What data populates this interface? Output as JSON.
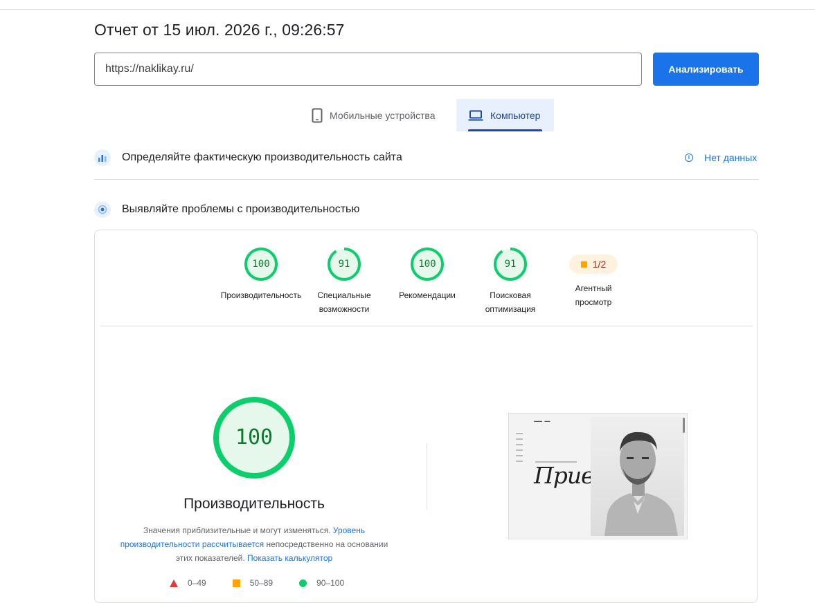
{
  "report": {
    "title": "Отчет от 15 июл. 2026 г., 09:26:57",
    "url_value": "https://naklikay.ru/",
    "analyze_label": "Анализировать"
  },
  "tabs": [
    {
      "label": "Мобильные устройства",
      "icon": "phone-icon",
      "active": false
    },
    {
      "label": "Компьютер",
      "icon": "laptop-icon",
      "active": true
    }
  ],
  "field_data": {
    "heading": "Определяйте фактическую производительность сайта",
    "status": "Нет данных"
  },
  "lab_data": {
    "heading": "Выявляйте проблемы с производительностью"
  },
  "scores": [
    {
      "value": "100",
      "label_line1": "Производительность",
      "label_line2": "",
      "fraction": 1.0
    },
    {
      "value": "91",
      "label_line1": "Специальные",
      "label_line2": "возможности",
      "fraction": 0.91
    },
    {
      "value": "100",
      "label_line1": "Рекомендации",
      "label_line2": "",
      "fraction": 1.0
    },
    {
      "value": "91",
      "label_line1": "Поисковая",
      "label_line2": "оптимизация",
      "fraction": 0.91
    }
  ],
  "agent": {
    "value": "1/2",
    "label_line1": "Агентный",
    "label_line2": "просмотр"
  },
  "performance": {
    "score": "100",
    "score_fraction": 1.0,
    "title": "Производительность",
    "desc_part1": "Значения приблизительные и могут изменяться. ",
    "desc_link1": "Уровень производительности рассчитывается",
    "desc_part2": " непосредственно на основании этих показателей. ",
    "desc_link2": "Показать калькулятор"
  },
  "legend": [
    {
      "range": "0–49",
      "shape": "triangle",
      "color": "#e53935"
    },
    {
      "range": "50–89",
      "shape": "square",
      "color": "#ffa400"
    },
    {
      "range": "90–100",
      "shape": "circle",
      "color": "#0cce6b"
    }
  ],
  "preview": {
    "hello_text": "Привет!"
  },
  "colors": {
    "accent": "#1a73e8",
    "good": "#0cce6b",
    "good_text": "#0c7a2f",
    "average": "#ffa400",
    "poor": "#e53935"
  }
}
